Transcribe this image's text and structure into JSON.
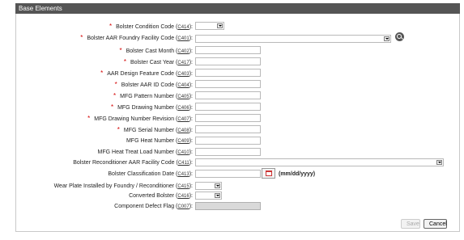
{
  "section_title": "Base Elements",
  "fields": [
    {
      "label": "Bolster Condition Code",
      "code": "C414",
      "required": true,
      "type": "select-small"
    },
    {
      "label": "Bolster AAR Foundry Facility Code",
      "code": "C401",
      "required": true,
      "type": "select-wide-search"
    },
    {
      "label": "Bolster Cast Month",
      "code": "C402",
      "required": true,
      "type": "text"
    },
    {
      "label": "Bolster Cast Year",
      "code": "C417",
      "required": true,
      "type": "text"
    },
    {
      "label": "AAR Design Feature Code",
      "code": "C403",
      "required": true,
      "type": "text"
    },
    {
      "label": "Bolster AAR ID Code",
      "code": "C404",
      "required": true,
      "type": "text"
    },
    {
      "label": "MFG Pattern Number",
      "code": "C405",
      "required": true,
      "type": "text"
    },
    {
      "label": "MFG Drawing Number",
      "code": "C406",
      "required": true,
      "type": "text"
    },
    {
      "label": "MFG Drawing Number Revision",
      "code": "C407",
      "required": true,
      "type": "text"
    },
    {
      "label": "MFG Serial Number",
      "code": "C408",
      "required": true,
      "type": "text"
    },
    {
      "label": "MFG Heat Number",
      "code": "C409",
      "required": false,
      "type": "text"
    },
    {
      "label": "MFG Heat Treat Load Number",
      "code": "C410",
      "required": false,
      "type": "text"
    },
    {
      "label": "Bolster Reconditioner AAR Facility Code",
      "code": "C411",
      "required": false,
      "type": "select-wide2"
    },
    {
      "label": "Bolster Classification Date",
      "code": "C413",
      "required": false,
      "type": "date"
    },
    {
      "label": "Wear Plate Installed by Foundry / Reconditioner",
      "code": "C415",
      "required": false,
      "type": "select-tiny"
    },
    {
      "label": "Converted Bolster",
      "code": "C416",
      "required": false,
      "type": "select-tiny"
    },
    {
      "label": "Component Defect Flag",
      "code": "C007",
      "required": false,
      "type": "disabled"
    }
  ],
  "date_format_hint": "(mm/dd/yyyy)",
  "buttons": {
    "save": "Save",
    "cancel": "Cancel"
  }
}
